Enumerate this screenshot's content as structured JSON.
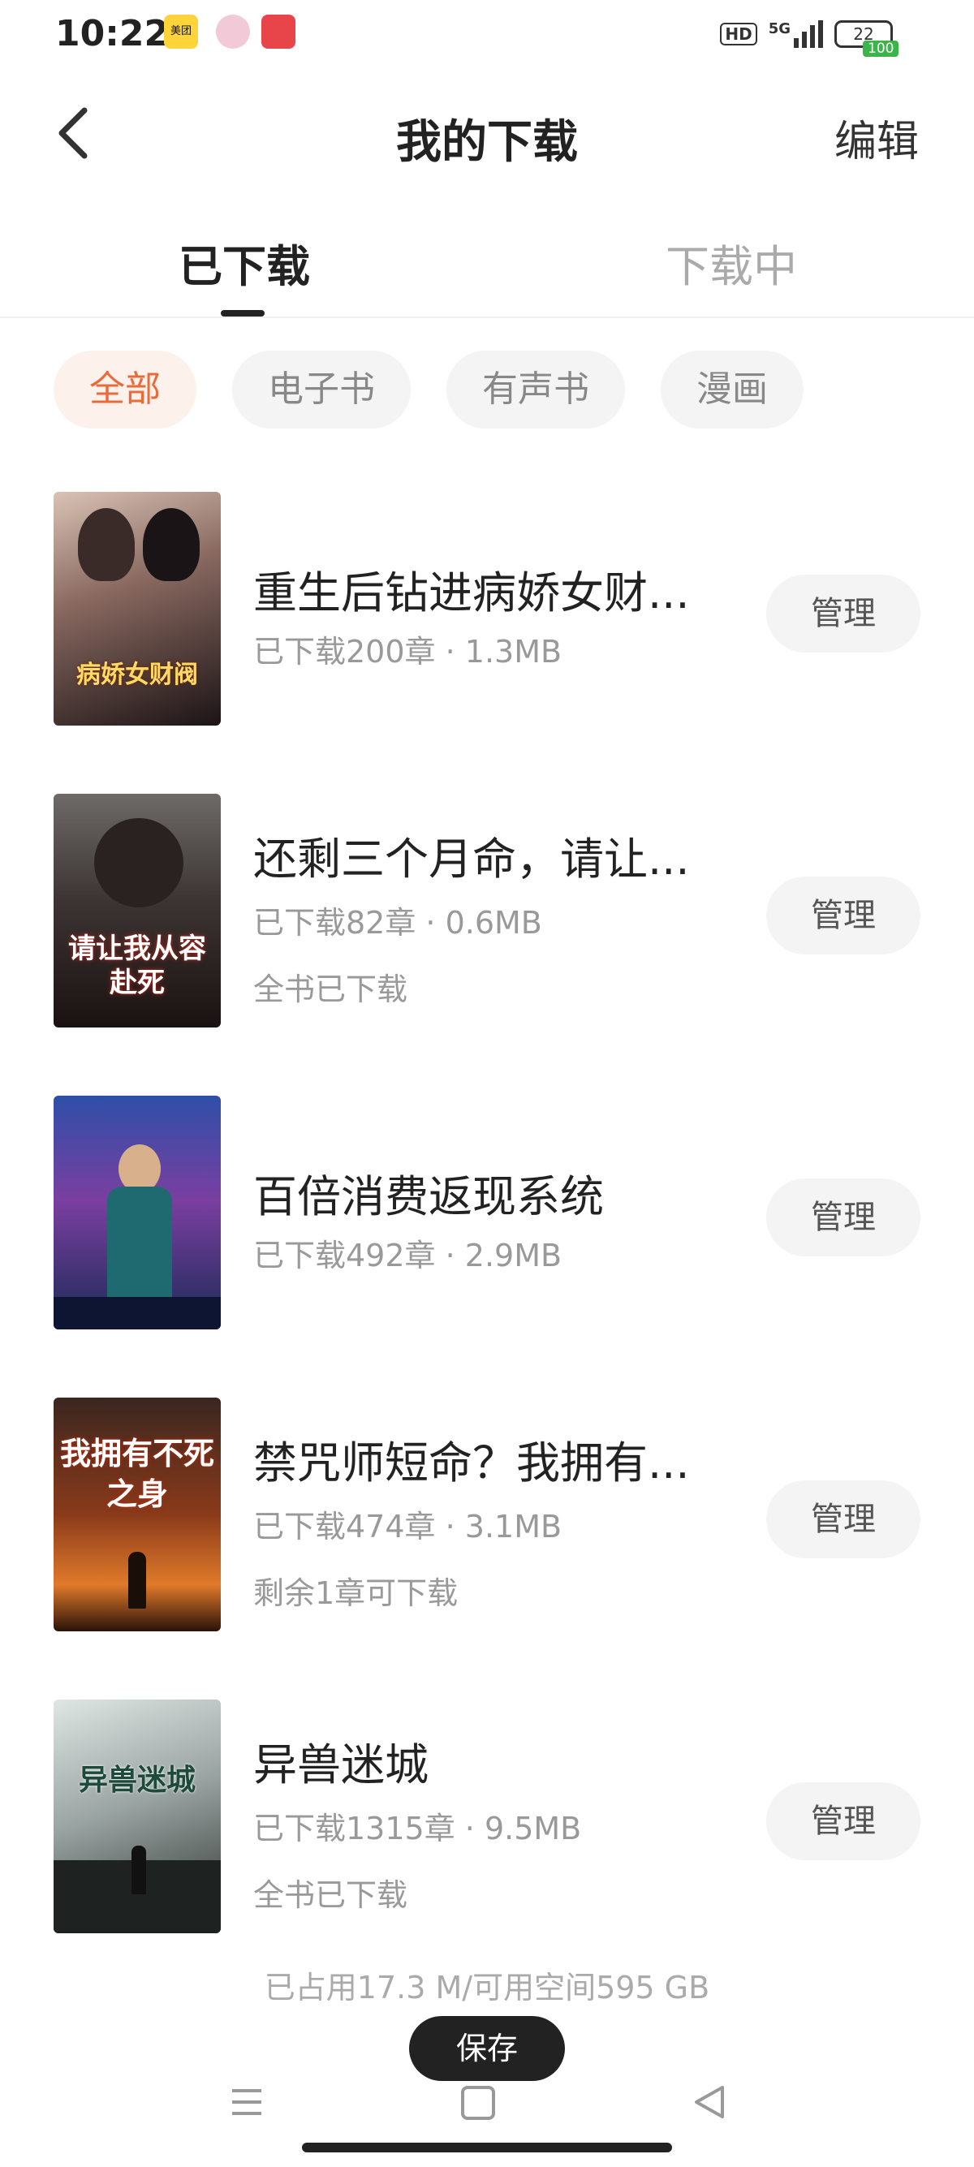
{
  "status_bar": {
    "time": "10:22",
    "apps": [
      "美团",
      "",
      ""
    ],
    "hd_label": "HD",
    "network_label": "5G",
    "battery_level": "22",
    "battery_badge": "100"
  },
  "header": {
    "title": "我的下载",
    "edit_label": "编辑",
    "back_icon": "chevron-left-icon"
  },
  "tabs": [
    {
      "label": "已下载",
      "active": true
    },
    {
      "label": "下载中",
      "active": false
    }
  ],
  "filters": [
    {
      "label": "全部",
      "active": true
    },
    {
      "label": "电子书",
      "active": false
    },
    {
      "label": "有声书",
      "active": false
    },
    {
      "label": "漫画",
      "active": false
    }
  ],
  "books": [
    {
      "title": "重生后钻进病娇女财...",
      "meta": "已下载200章 · 1.3MB",
      "extra": "",
      "manage_label": "管理",
      "cover_text": "病娇女财阀"
    },
    {
      "title": "还剩三个月命，请让...",
      "meta": "已下载82章 · 0.6MB",
      "extra": "全书已下载",
      "manage_label": "管理",
      "cover_text": "请让我从容赴死"
    },
    {
      "title": "百倍消费返现系统",
      "meta": "已下载492章 · 2.9MB",
      "extra": "",
      "manage_label": "管理",
      "cover_text": ""
    },
    {
      "title": "禁咒师短命？我拥有...",
      "meta": "已下载474章 · 3.1MB",
      "extra": "剩余1章可下载",
      "manage_label": "管理",
      "cover_text": "我拥有不死之身"
    },
    {
      "title": "异兽迷城",
      "meta": "已下载1315章 · 9.5MB",
      "extra": "全书已下载",
      "manage_label": "管理",
      "cover_text": "异兽迷城"
    }
  ],
  "storage_text": "已占用17.3 M/可用空间595 GB",
  "save_label": "保存",
  "colors": {
    "accent": "#e96a3b",
    "chip_bg": "#f4f4f4",
    "active_chip_bg": "#fdf1ec"
  }
}
